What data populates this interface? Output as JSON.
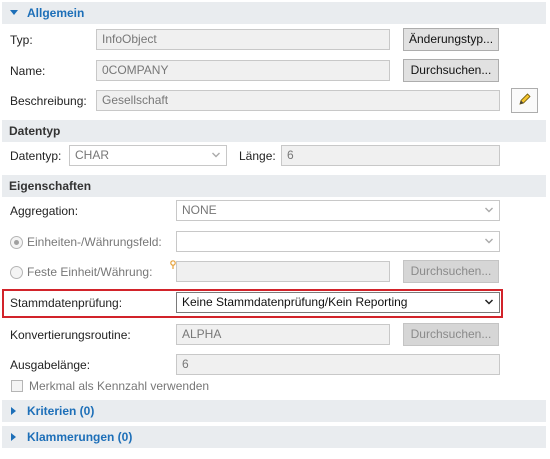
{
  "sections": {
    "allgemein": "Allgemein",
    "datentyp": "Datentyp",
    "eigenschaften": "Eigenschaften",
    "kriterien": "Kriterien (0)",
    "klammerungen": "Klammerungen (0)"
  },
  "allgemein": {
    "typ_label": "Typ:",
    "typ_value": "InfoObject",
    "typ_button": "Änderungstyp...",
    "name_label": "Name:",
    "name_value": "0COMPANY",
    "name_button": "Durchsuchen...",
    "beschreibung_label": "Beschreibung:",
    "beschreibung_value": "Gesellschaft"
  },
  "datentyp": {
    "datentyp_label": "Datentyp:",
    "datentyp_value": "CHAR",
    "laenge_label": "Länge:",
    "laenge_value": "6"
  },
  "eigenschaften": {
    "aggregation_label": "Aggregation:",
    "aggregation_value": "NONE",
    "einheiten_label": "Einheiten-/Währungsfeld:",
    "einheiten_value": "",
    "feste_label": "Feste Einheit/Währung:",
    "feste_value": "",
    "feste_button": "Durchsuchen...",
    "stamm_label": "Stammdatenprüfung:",
    "stamm_value": "Keine Stammdatenprüfung/Kein Reporting",
    "konv_label": "Konvertierungsroutine:",
    "konv_value": "ALPHA",
    "konv_button": "Durchsuchen...",
    "ausgabe_label": "Ausgabelänge:",
    "ausgabe_value": "6",
    "kennzahl_label": "Merkmal als Kennzahl verwenden"
  },
  "colors": {
    "link_blue": "#1d6fb8",
    "highlight_red": "#d2232a",
    "section_bg": "#e9ecef"
  },
  "icons": [
    "triangle-down-icon",
    "triangle-right-icon",
    "chevron-down-icon",
    "pencil-icon",
    "warning-icon"
  ]
}
